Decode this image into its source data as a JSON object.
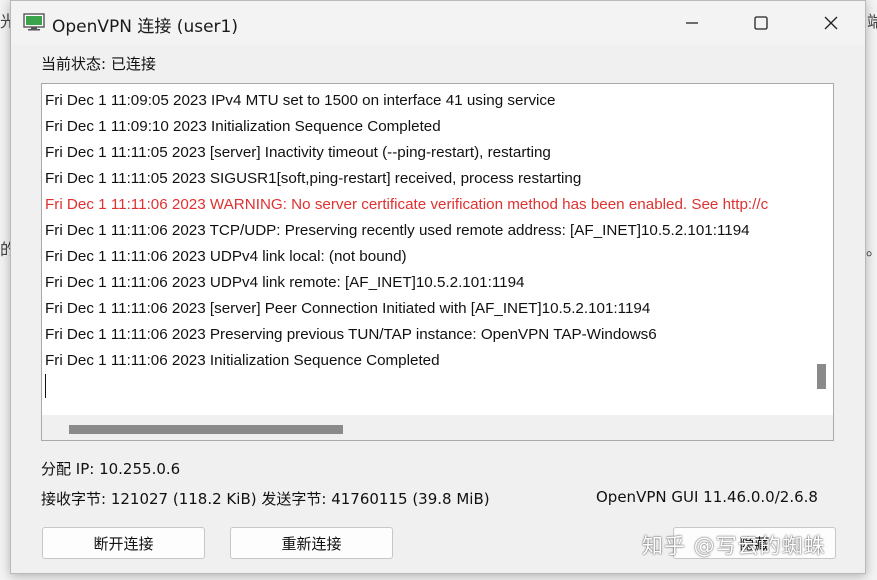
{
  "window": {
    "title": "OpenVPN 连接 (user1)"
  },
  "status": {
    "label": "当前状态:",
    "value": "已连接"
  },
  "log": [
    {
      "text": "Fri Dec  1 11:09:05 2023 IPv4 MTU set to 1500 on interface 41 using service",
      "level": "info"
    },
    {
      "text": "Fri Dec  1 11:09:10 2023 Initialization Sequence Completed",
      "level": "info"
    },
    {
      "text": "Fri Dec  1 11:11:05 2023 [server] Inactivity timeout (--ping-restart), restarting",
      "level": "info"
    },
    {
      "text": "Fri Dec  1 11:11:05 2023 SIGUSR1[soft,ping-restart] received, process restarting",
      "level": "info"
    },
    {
      "text": "Fri Dec  1 11:11:06 2023 WARNING: No server certificate verification method has been enabled.  See http://c",
      "level": "warning"
    },
    {
      "text": "Fri Dec  1 11:11:06 2023 TCP/UDP: Preserving recently used remote address: [AF_INET]10.5.2.101:1194",
      "level": "info"
    },
    {
      "text": "Fri Dec  1 11:11:06 2023 UDPv4 link local: (not bound)",
      "level": "info"
    },
    {
      "text": "Fri Dec  1 11:11:06 2023 UDPv4 link remote: [AF_INET]10.5.2.101:1194",
      "level": "info"
    },
    {
      "text": "Fri Dec  1 11:11:06 2023 [server] Peer Connection Initiated with [AF_INET]10.5.2.101:1194",
      "level": "info"
    },
    {
      "text": "Fri Dec  1 11:11:06 2023 Preserving previous TUN/TAP instance: OpenVPN TAP-Windows6",
      "level": "info"
    },
    {
      "text": "Fri Dec  1 11:11:06 2023 Initialization Sequence Completed",
      "level": "info"
    }
  ],
  "info": {
    "ip_label": "分配 IP:",
    "ip_value": "10.255.0.6",
    "received_label": "接收字节:",
    "received_value": "121027 (118.2 KiB)",
    "sent_label": "发送字节:",
    "sent_value": "41760115 (39.8 MiB)",
    "version": "OpenVPN GUI 11.46.0.0/2.6.8"
  },
  "buttons": {
    "disconnect": "断开连接",
    "reconnect": "重新连接",
    "hide": "隐藏"
  },
  "watermark": "知乎 @写云的蜘蛛",
  "background_chars": {
    "left_top": "光",
    "right_top": "端",
    "left_mid": "的",
    "right_mid": "。"
  },
  "colors": {
    "warning_text": "#e03131"
  }
}
